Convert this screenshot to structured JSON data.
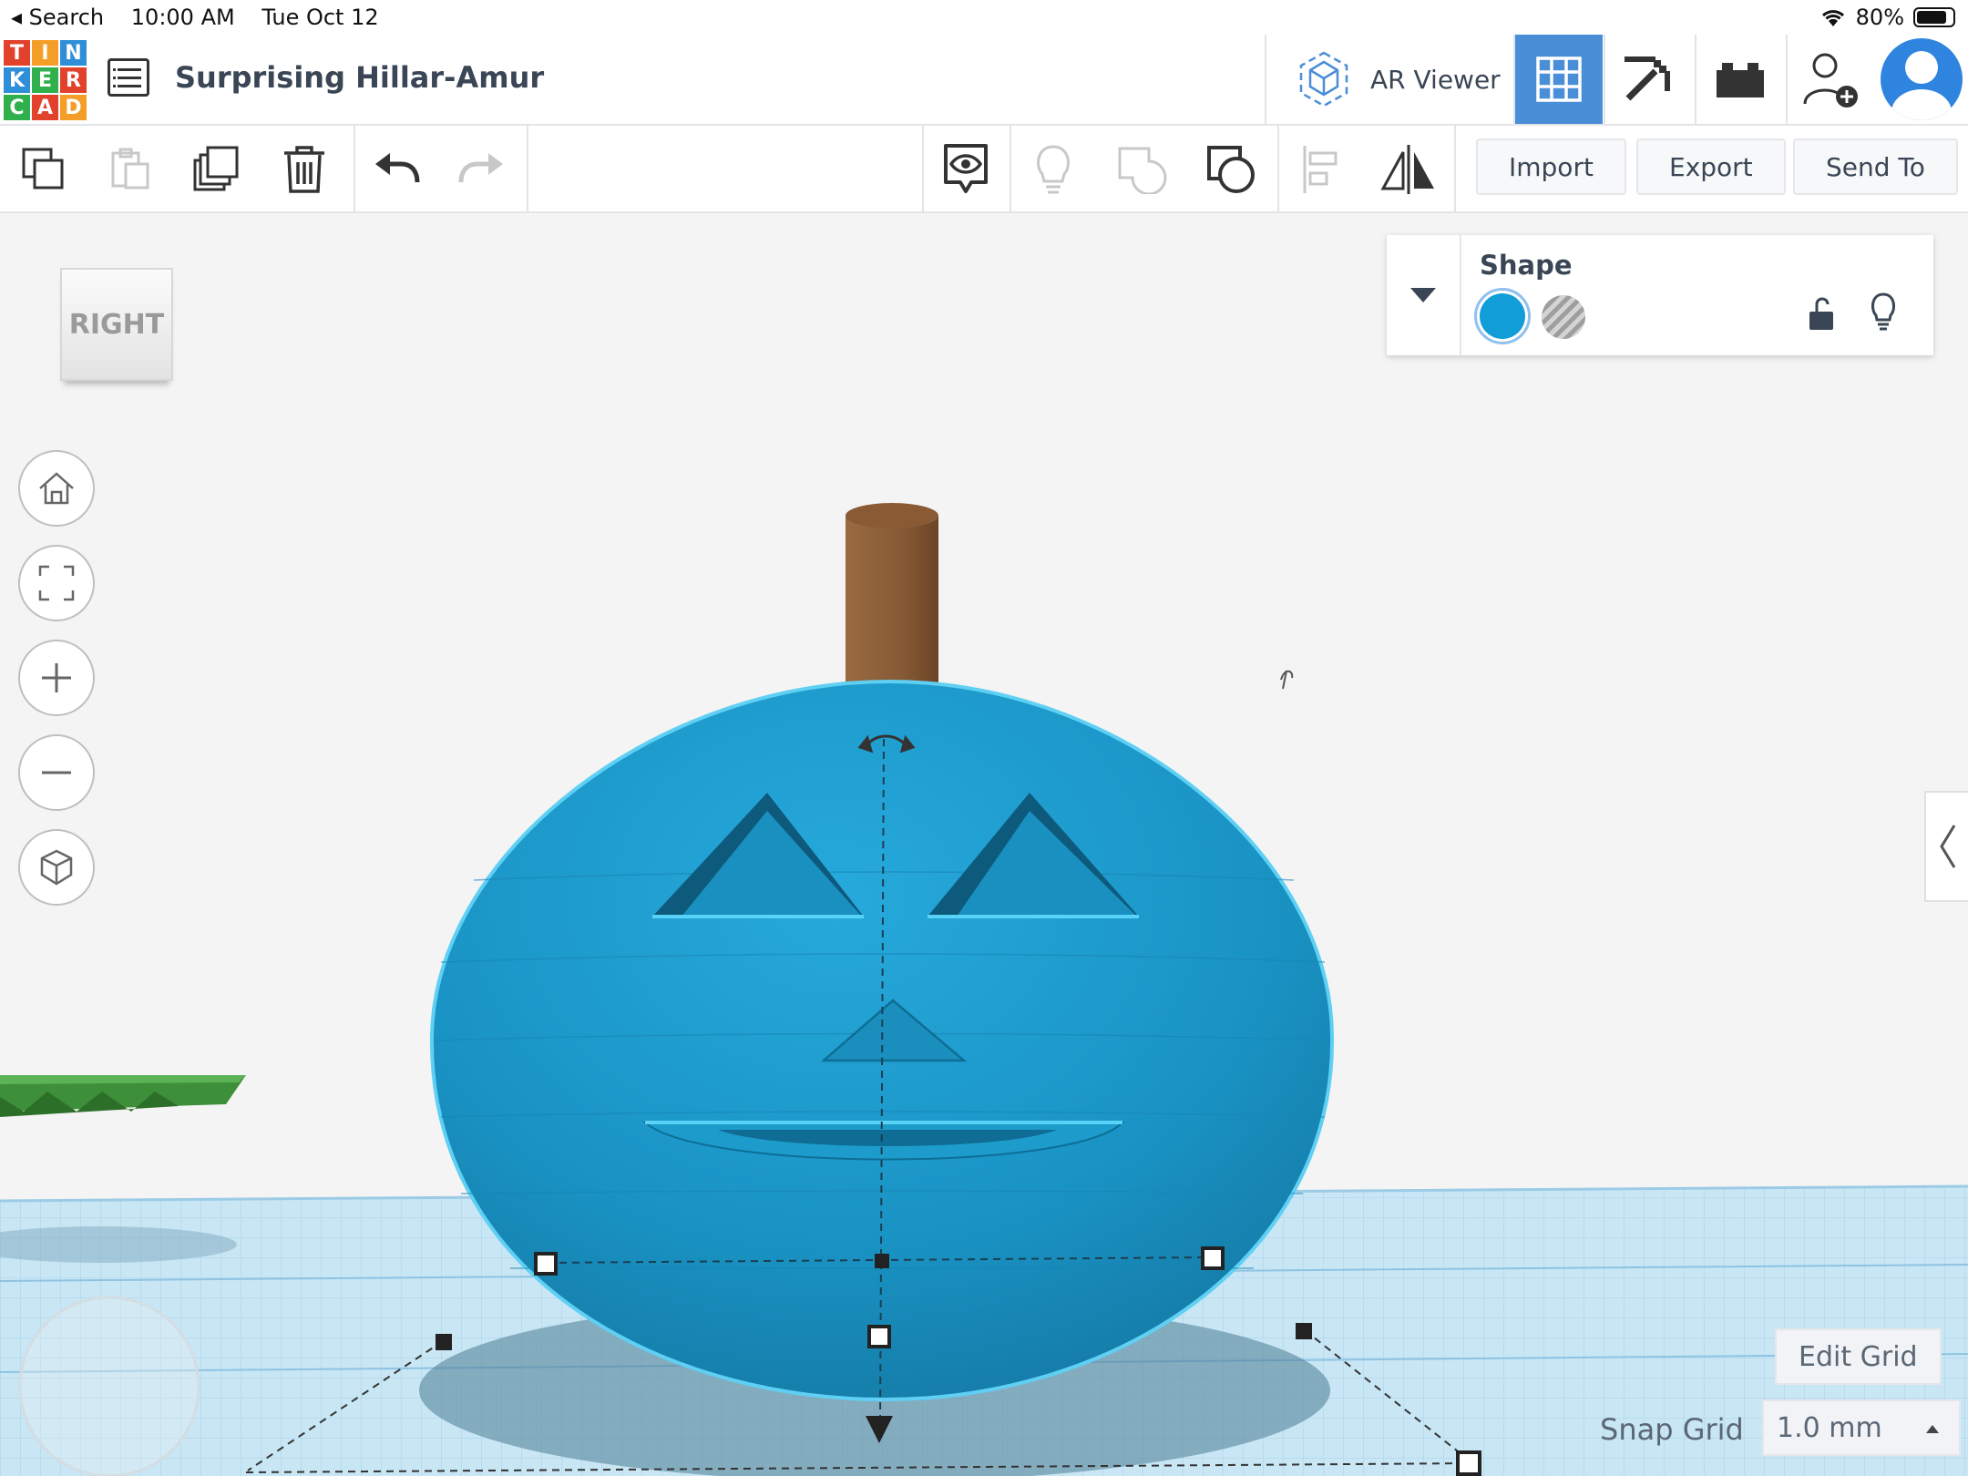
{
  "status_bar": {
    "back_label": "◂ Search",
    "time": "10:00 AM",
    "date": "Tue Oct 12",
    "battery": "80%"
  },
  "logo": {
    "letters": [
      "T",
      "I",
      "N",
      "K",
      "E",
      "R",
      "C",
      "A",
      "D"
    ],
    "colors": [
      "#e2412c",
      "#f49e28",
      "#2f8ed8",
      "#2f8ed8",
      "#2fb04c",
      "#e2412c",
      "#2fb04c",
      "#e2412c",
      "#f49e28"
    ]
  },
  "header": {
    "design_title": "Surprising Hillar-Amur",
    "ar_viewer_label": "AR Viewer"
  },
  "toolbar": {
    "import_label": "Import",
    "export_label": "Export",
    "send_to_label": "Send To"
  },
  "viewcube": {
    "face_label": "RIGHT"
  },
  "inspector": {
    "title": "Shape",
    "solid_color": "#119dd8"
  },
  "grid": {
    "edit_grid_label": "Edit Grid",
    "snap_label": "Snap Grid",
    "snap_value": "1.0 mm"
  },
  "colors": {
    "accent": "#4a8ed8",
    "pumpkin": "#1d9fd0",
    "stem": "#8a5a34",
    "workplane": "#c8e6f4"
  }
}
